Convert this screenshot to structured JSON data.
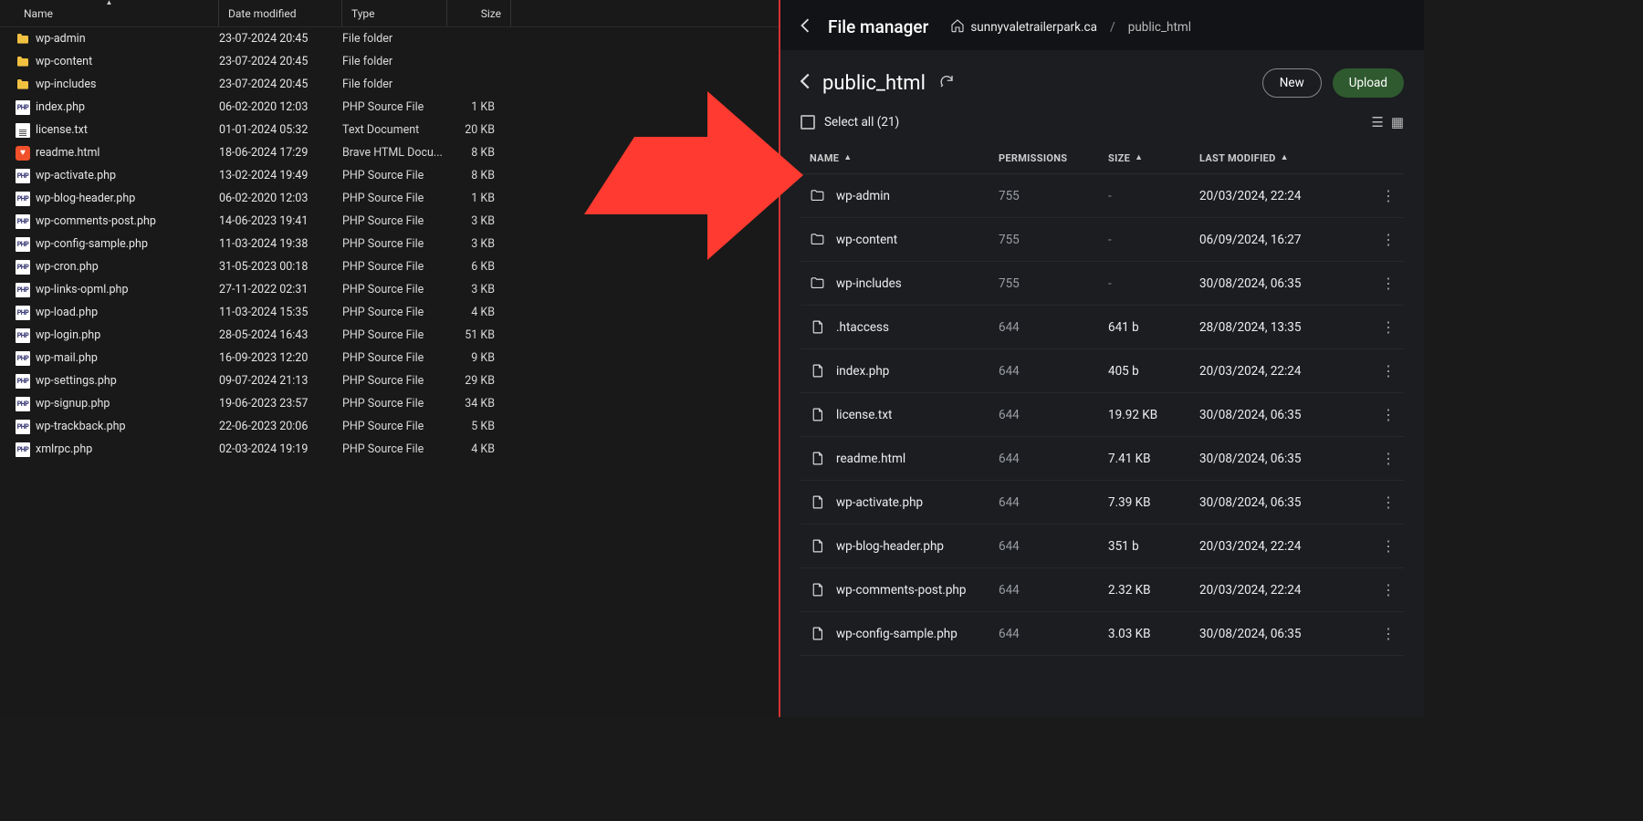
{
  "explorer": {
    "columns": {
      "name": "Name",
      "date": "Date modified",
      "type": "Type",
      "size": "Size"
    },
    "rows": [
      {
        "icon": "folder",
        "name": "wp-admin",
        "date": "23-07-2024 20:45",
        "type": "File folder",
        "size": ""
      },
      {
        "icon": "folder",
        "name": "wp-content",
        "date": "23-07-2024 20:45",
        "type": "File folder",
        "size": ""
      },
      {
        "icon": "folder",
        "name": "wp-includes",
        "date": "23-07-2024 20:45",
        "type": "File folder",
        "size": ""
      },
      {
        "icon": "php",
        "name": "index.php",
        "date": "06-02-2020 12:03",
        "type": "PHP Source File",
        "size": "1 KB"
      },
      {
        "icon": "txt",
        "name": "license.txt",
        "date": "01-01-2024 05:32",
        "type": "Text Document",
        "size": "20 KB"
      },
      {
        "icon": "brave",
        "name": "readme.html",
        "date": "18-06-2024 17:29",
        "type": "Brave HTML Docu...",
        "size": "8 KB"
      },
      {
        "icon": "php",
        "name": "wp-activate.php",
        "date": "13-02-2024 19:49",
        "type": "PHP Source File",
        "size": "8 KB"
      },
      {
        "icon": "php",
        "name": "wp-blog-header.php",
        "date": "06-02-2020 12:03",
        "type": "PHP Source File",
        "size": "1 KB"
      },
      {
        "icon": "php",
        "name": "wp-comments-post.php",
        "date": "14-06-2023 19:41",
        "type": "PHP Source File",
        "size": "3 KB"
      },
      {
        "icon": "php",
        "name": "wp-config-sample.php",
        "date": "11-03-2024 19:38",
        "type": "PHP Source File",
        "size": "3 KB"
      },
      {
        "icon": "php",
        "name": "wp-cron.php",
        "date": "31-05-2023 00:18",
        "type": "PHP Source File",
        "size": "6 KB"
      },
      {
        "icon": "php",
        "name": "wp-links-opml.php",
        "date": "27-11-2022 02:31",
        "type": "PHP Source File",
        "size": "3 KB"
      },
      {
        "icon": "php",
        "name": "wp-load.php",
        "date": "11-03-2024 15:35",
        "type": "PHP Source File",
        "size": "4 KB"
      },
      {
        "icon": "php",
        "name": "wp-login.php",
        "date": "28-05-2024 16:43",
        "type": "PHP Source File",
        "size": "51 KB"
      },
      {
        "icon": "php",
        "name": "wp-mail.php",
        "date": "16-09-2023 12:20",
        "type": "PHP Source File",
        "size": "9 KB"
      },
      {
        "icon": "php",
        "name": "wp-settings.php",
        "date": "09-07-2024 21:13",
        "type": "PHP Source File",
        "size": "29 KB"
      },
      {
        "icon": "php",
        "name": "wp-signup.php",
        "date": "19-06-2023 23:57",
        "type": "PHP Source File",
        "size": "34 KB"
      },
      {
        "icon": "php",
        "name": "wp-trackback.php",
        "date": "22-06-2023 20:06",
        "type": "PHP Source File",
        "size": "5 KB"
      },
      {
        "icon": "php",
        "name": "xmlrpc.php",
        "date": "02-03-2024 19:19",
        "type": "PHP Source File",
        "size": "4 KB"
      }
    ]
  },
  "hpanel": {
    "breadcrumb": {
      "title": "File manager",
      "domain": "sunnyvaletrailerpark.ca",
      "leaf": "public_html"
    },
    "dir": {
      "name": "public_html"
    },
    "buttons": {
      "new": "New",
      "upload": "Upload"
    },
    "selectall": "Select all (21)",
    "columns": {
      "name": "NAME",
      "perm": "PERMISSIONS",
      "size": "SIZE",
      "mod": "LAST MODIFIED"
    },
    "rows": [
      {
        "icon": "folder",
        "name": "wp-admin",
        "perm": "755",
        "size": "-",
        "mod": "20/03/2024, 22:24"
      },
      {
        "icon": "folder",
        "name": "wp-content",
        "perm": "755",
        "size": "-",
        "mod": "06/09/2024, 16:27"
      },
      {
        "icon": "folder",
        "name": "wp-includes",
        "perm": "755",
        "size": "-",
        "mod": "30/08/2024, 06:35"
      },
      {
        "icon": "file",
        "name": ".htaccess",
        "perm": "644",
        "size": "641 b",
        "mod": "28/08/2024, 13:35"
      },
      {
        "icon": "file",
        "name": "index.php",
        "perm": "644",
        "size": "405 b",
        "mod": "20/03/2024, 22:24"
      },
      {
        "icon": "file",
        "name": "license.txt",
        "perm": "644",
        "size": "19.92 KB",
        "mod": "30/08/2024, 06:35"
      },
      {
        "icon": "file",
        "name": "readme.html",
        "perm": "644",
        "size": "7.41 KB",
        "mod": "30/08/2024, 06:35"
      },
      {
        "icon": "file",
        "name": "wp-activate.php",
        "perm": "644",
        "size": "7.39 KB",
        "mod": "30/08/2024, 06:35"
      },
      {
        "icon": "file",
        "name": "wp-blog-header.php",
        "perm": "644",
        "size": "351 b",
        "mod": "20/03/2024, 22:24"
      },
      {
        "icon": "file",
        "name": "wp-comments-post.php",
        "perm": "644",
        "size": "2.32 KB",
        "mod": "20/03/2024, 22:24"
      },
      {
        "icon": "file",
        "name": "wp-config-sample.php",
        "perm": "644",
        "size": "3.03 KB",
        "mod": "30/08/2024, 06:35"
      }
    ]
  }
}
